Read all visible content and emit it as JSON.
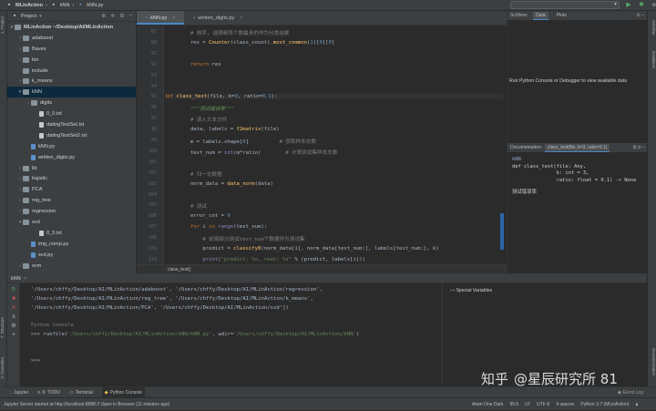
{
  "titlebar": {
    "project": "MLinAction",
    "folder": "kNN",
    "file": "kNN.py",
    "run_config": "",
    "sep": "›"
  },
  "sidebar_left": {
    "project_label": "1: Project",
    "structure_label": "7: Structure",
    "favorites_label": "2: Favorites"
  },
  "project_panel": {
    "title": "Project",
    "tree": [
      {
        "label": "MLinAction  ~/Desktop/AI/MLinAction",
        "indent": 0,
        "icon": "folder",
        "open": true
      },
      {
        "label": "adaboost",
        "indent": 1,
        "icon": "folder",
        "open": false
      },
      {
        "label": "Baves",
        "indent": 1,
        "icon": "folder",
        "open": false
      },
      {
        "label": "bin",
        "indent": 1,
        "icon": "folder",
        "open": false
      },
      {
        "label": "include",
        "indent": 1,
        "icon": "folder",
        "open": null
      },
      {
        "label": "k_means",
        "indent": 1,
        "icon": "folder",
        "open": false
      },
      {
        "label": "kNN",
        "indent": 1,
        "icon": "folder",
        "open": true,
        "selected": true
      },
      {
        "label": "digits",
        "indent": 2,
        "icon": "folder",
        "open": false
      },
      {
        "label": "0_0.txt",
        "indent": 3,
        "icon": "txt",
        "open": null
      },
      {
        "label": "datingTestSet.txt",
        "indent": 3,
        "icon": "txt",
        "open": null
      },
      {
        "label": "datingTestSet2.txt",
        "indent": 3,
        "icon": "txt",
        "open": null
      },
      {
        "label": "kNN.py",
        "indent": 2,
        "icon": "py",
        "open": null
      },
      {
        "label": "written_digits.py",
        "indent": 2,
        "icon": "py",
        "open": null
      },
      {
        "label": "lib",
        "indent": 1,
        "icon": "folder",
        "open": false
      },
      {
        "label": "logistic",
        "indent": 1,
        "icon": "folder",
        "open": false
      },
      {
        "label": "PCA",
        "indent": 1,
        "icon": "folder",
        "open": false
      },
      {
        "label": "reg_tree",
        "indent": 1,
        "icon": "folder",
        "open": false
      },
      {
        "label": "regression",
        "indent": 1,
        "icon": "folder",
        "open": false
      },
      {
        "label": "svd",
        "indent": 1,
        "icon": "folder",
        "open": true
      },
      {
        "label": "0_5.txt",
        "indent": 3,
        "icon": "txt",
        "open": null
      },
      {
        "label": "img_comp.py",
        "indent": 2,
        "icon": "py",
        "open": null
      },
      {
        "label": "svd.py",
        "indent": 2,
        "icon": "py",
        "open": null
      },
      {
        "label": "svm",
        "indent": 1,
        "icon": "folder",
        "open": false
      }
    ]
  },
  "editor": {
    "tabs": [
      {
        "label": "kNN.py",
        "active": true
      },
      {
        "label": "written_digits.py",
        "active": false
      }
    ],
    "breadcrumb": "class_test()",
    "lines": [
      {
        "n": "87",
        "html": "        <span class=\"cm\"># 排序, 选择频率个数最多的作为分类结果</span>"
      },
      {
        "n": "88",
        "html": "        res = <span class=\"fn\">Counter</span>(class_count).<span class=\"fn\">most_common</span>(<span class=\"nm\">1</span>)[<span class=\"nm\">0</span>][<span class=\"nm\">0</span>]"
      },
      {
        "n": "91",
        "html": ""
      },
      {
        "n": "92",
        "html": "        <span class=\"kw\">return</span> res"
      },
      {
        "n": "93",
        "html": ""
      },
      {
        "n": "94",
        "html": ""
      },
      {
        "n": "95",
        "html": "<span class=\"kw\">def</span> <span class=\"fn\">class_test</span>(file, k=<span class=\"nm\">3</span>, ratio=<span class=\"nm\">0.1</span>):",
        "hl": true
      },
      {
        "n": "96",
        "html": "        <span class=\"dc\">\"\"\"测试错误率\"\"\"</span>"
      },
      {
        "n": "97",
        "html": "        <span class=\"cm\"># 读入文本文件</span>"
      },
      {
        "n": "98",
        "html": "        data, labels = <span class=\"fn\">f2matrix</span>(file)"
      },
      {
        "n": "99",
        "html": "        m = labels.shape[<span class=\"nm\">0</span>]          <span class=\"cm\"># 获取样本总数</span>"
      },
      {
        "n": "100",
        "html": "        test_num = <span class=\"bi\">int</span>(m*ratio)        <span class=\"cm\"># 计算测试集样本总数</span>"
      },
      {
        "n": "101",
        "html": ""
      },
      {
        "n": "102",
        "html": "        <span class=\"cm\"># 归一化数据</span>"
      },
      {
        "n": "103",
        "html": "        norm_data = <span class=\"fn\">data_norm</span>(data)"
      },
      {
        "n": "104",
        "html": ""
      },
      {
        "n": "105",
        "html": "        <span class=\"cm\"># 测试</span>"
      },
      {
        "n": "106",
        "html": "        error_cnt = <span class=\"nm\">0</span>"
      },
      {
        "n": "107",
        "html": "        <span class=\"kw\">for</span> i <span class=\"kw\">in</span> <span class=\"bi\">range</span>(test_num):"
      },
      {
        "n": "108",
        "html": "            <span class=\"cm\"># 前面部分测试test_num个数据作为测试集</span>"
      },
      {
        "n": "109",
        "html": "            predict = <span class=\"fn\">classify0</span>(norm_data[i], norm_data[test_num:], labels[test_num:], k)"
      },
      {
        "n": "110",
        "html": "            <span class=\"bi\">print</span>(<span class=\"st\">\"predict: %s, real: %s\"</span> % (predict, labels[i]))"
      }
    ]
  },
  "sciview": {
    "title": "SciView:",
    "tabs": [
      "Data",
      "Plots"
    ],
    "active_tab": "Data",
    "message": "Run Python Console or Debugger to view available data"
  },
  "documentation": {
    "title": "Documentation:",
    "tab": "class_test(file, k=3, ratio=0.1)",
    "module": "kNN",
    "sig_lines": [
      "def class_test(file: Any,",
      "               k: int = 3,",
      "               ratio: float = 0.1) -> None"
    ],
    "doc": "测试错误率"
  },
  "sidebar_right": {
    "sciview_label": "SciView",
    "database_label": "Database",
    "documentation_label": "Documentation"
  },
  "console": {
    "title": "kNN",
    "lines": [
      "'/Users/chffy/Desktop/AI/MLinAction/adaboost', '/Users/chffy/Desktop/AI/MLinAction/regression',",
      "'/Users/chffy/Desktop/AI/MLinAction/reg_tree', '/Users/chffy/Desktop/AI/MLinAction/k_means',",
      "'/Users/chffy/Desktop/AI/MLinAction/PCA', '/Users/chffy/Desktop/AI/MLinAction/svd'])",
      "",
      "Python Console",
      ">>> runfile('/Users/chffy/Desktop/AI/MLinAction/kNN/kNN.py', wdir='/Users/chffy/Desktop/AI/MLinAction/kNN')",
      "",
      "",
      ">>>"
    ],
    "special_vars": "Special Variables"
  },
  "watermark": {
    "text": "知乎",
    "handle": "@星辰研究所 81"
  },
  "bottom_tabs": [
    {
      "label": "Jupyter",
      "icon": "circle"
    },
    {
      "label": "6: TODO",
      "icon": "list"
    },
    {
      "label": "Terminal",
      "icon": "terminal"
    },
    {
      "label": "Python Console",
      "icon": "python",
      "active": true
    }
  ],
  "event_log": "Event Log",
  "status": {
    "left": "Jupyter Server started at http://localhost:8888 // Open in Browser (11 minutes ago)",
    "theme": "Atom One Dark",
    "pos": "95:6",
    "lf": "LF",
    "enc": "UTF-8",
    "indent": "4 spaces",
    "interp": "Python 3.7 (MLinAction)"
  },
  "colors": {
    "accent": "#4a88c7",
    "background": "#2b2b2b",
    "panel": "#3c3f41"
  }
}
